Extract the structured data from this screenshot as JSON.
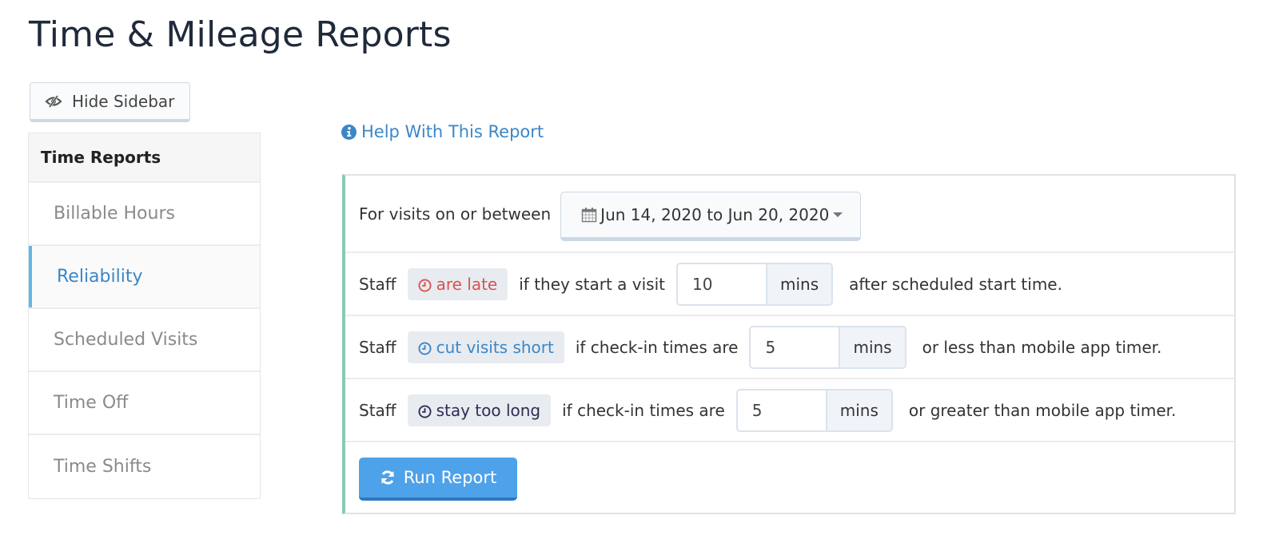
{
  "page": {
    "title": "Time & Mileage Reports"
  },
  "toolbar": {
    "hide_sidebar_label": "Hide Sidebar",
    "hide_sidebar_icon": "eye-slash-icon"
  },
  "sidebar": {
    "header": "Time Reports",
    "items": [
      {
        "label": "Billable Hours",
        "active": false
      },
      {
        "label": "Reliability",
        "active": true
      },
      {
        "label": "Scheduled Visits",
        "active": false
      },
      {
        "label": "Time Off",
        "active": false
      },
      {
        "label": "Time Shifts",
        "active": false
      }
    ],
    "active_color": "#3a87c7"
  },
  "help": {
    "label": "Help With This Report",
    "icon": "info-circle-icon"
  },
  "report": {
    "date_row": {
      "label": "For visits on or between",
      "date_range": "Jun 14, 2020 to Jun 20, 2020",
      "icon": "calendar-icon"
    },
    "rules": [
      {
        "subject": "Staff",
        "tag": "are late",
        "tag_color": "#d9534f",
        "condition": "if they start a visit",
        "value": "10",
        "unit": "mins",
        "suffix": "after scheduled start time."
      },
      {
        "subject": "Staff",
        "tag": "cut visits short",
        "tag_color": "#3a87c7",
        "condition": "if check-in times are",
        "value": "5",
        "unit": "mins",
        "suffix": "or less than mobile app timer."
      },
      {
        "subject": "Staff",
        "tag": "stay too long",
        "tag_color": "#2c2f55",
        "condition": "if check-in times are",
        "value": "5",
        "unit": "mins",
        "suffix": "or greater than mobile app timer."
      }
    ],
    "run_button": {
      "label": "Run Report",
      "icon": "refresh-icon",
      "color": "#4da2ea"
    },
    "accent_color": "#87cbb2"
  }
}
